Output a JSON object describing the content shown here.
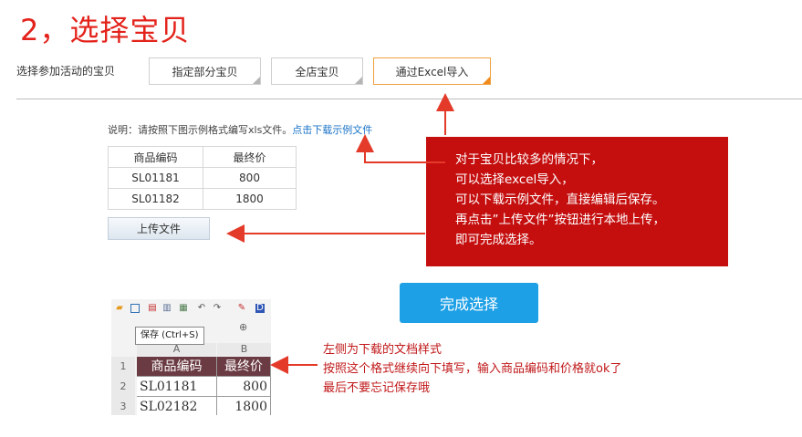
{
  "step_title": "2，选择宝贝",
  "select_label": "选择参加活动的宝贝",
  "options": [
    {
      "label": "指定部分宝贝",
      "selected": false
    },
    {
      "label": "全店宝贝",
      "selected": false
    },
    {
      "label": "通过Excel导入",
      "selected": true
    }
  ],
  "description": {
    "text": "说明：请按照下图示例格式编写xls文件。",
    "link": "点击下载示例文件"
  },
  "sample_table": {
    "headers": [
      "商品编码",
      "最终价"
    ],
    "rows": [
      [
        "SL01181",
        "800"
      ],
      [
        "SL01182",
        "1800"
      ]
    ]
  },
  "upload_button": "上传文件",
  "finish_button": "完成选择",
  "note_box": {
    "lines": [
      "对于宝贝比较多的情况下，",
      "可以选择excel导入，",
      "可以下载示例文件，直接编辑后保存。",
      "再点击”上传文件”按钮进行本地上传，",
      "即可完成选择。"
    ]
  },
  "excel_preview": {
    "tooltip": "保存 (Ctrl+S)",
    "columns": [
      "A",
      "B"
    ],
    "row_numbers": [
      "1",
      "2",
      "3"
    ],
    "headers": [
      "商品编码",
      "最终价"
    ],
    "rows": [
      [
        "SL01181",
        "800"
      ],
      [
        "SL02182",
        "1800"
      ]
    ],
    "toolbar_icons": [
      "open-icon",
      "save-icon",
      "pdf-icon",
      "print-preview-icon",
      "print-icon",
      "undo-icon",
      "redo-icon",
      "paste-icon",
      "format-icon"
    ]
  },
  "excel_note": {
    "lines": [
      "左侧为下载的文档样式",
      "按照这个格式继续向下填写，输入商品编码和价格就ok了",
      "最后不要忘记保存哦"
    ]
  },
  "colors": {
    "title_red": "#e3231b",
    "note_box_red": "#c50f0f",
    "finish_blue": "#1ea0e6",
    "link_blue": "#1a73c8",
    "arrow_red": "#e33a2a",
    "active_orange": "#f08a1c",
    "excel_header": "#6b3b43"
  }
}
